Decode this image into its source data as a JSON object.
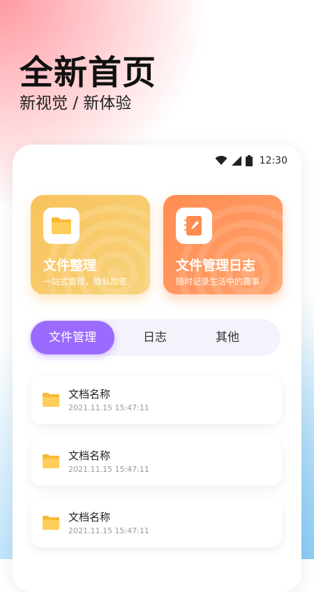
{
  "hero": {
    "title": "全新首页",
    "subtitle": "新视觉 / 新体验"
  },
  "status_bar": {
    "time": "12:30",
    "icons": [
      "wifi-icon",
      "signal-icon",
      "battery-icon"
    ]
  },
  "cards": [
    {
      "title": "文件整理",
      "desc": "一站式管理，隐私加密",
      "icon": "folder-icon",
      "color": "#f9c35d"
    },
    {
      "title": "文件管理日志",
      "desc": "随时记录生活中的趣事",
      "icon": "notebook-pen-icon",
      "color": "#ff8c52"
    }
  ],
  "tabs": [
    {
      "label": "文件管理",
      "active": true
    },
    {
      "label": "日志",
      "active": false
    },
    {
      "label": "其他",
      "active": false
    }
  ],
  "files": [
    {
      "name": "文档名称",
      "time": "2021.11.15  15:47:11"
    },
    {
      "name": "文档名称",
      "time": "2021.11.15  15:47:11"
    },
    {
      "name": "文档名称",
      "time": "2021.11.15  15:47:11"
    }
  ],
  "colors": {
    "accent": "#9b6bff",
    "folder": "#ffcd5a",
    "card_yellow": "#f9c35d",
    "card_orange": "#ff8c52"
  }
}
